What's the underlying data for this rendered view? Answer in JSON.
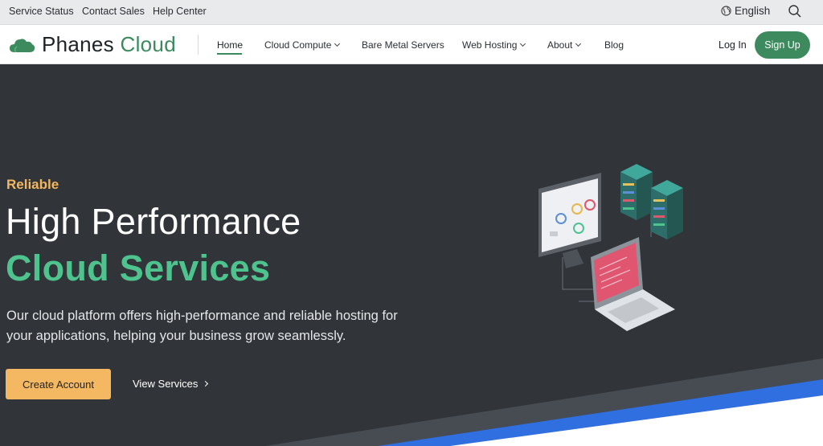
{
  "topbar": {
    "links": [
      "Service Status",
      "Contact Sales",
      "Help Center"
    ],
    "language": "English"
  },
  "nav": {
    "logo": {
      "part1": "Phanes",
      "part2": "Cloud"
    },
    "items": [
      {
        "label": "Home",
        "active": true
      },
      {
        "label": "Cloud Compute",
        "dropdown": true
      },
      {
        "label": "Bare Metal Servers"
      },
      {
        "label": "Web Hosting",
        "dropdown": true
      },
      {
        "label": "About",
        "dropdown": true
      },
      {
        "label": "Blog"
      }
    ],
    "login": "Log In",
    "signup": "Sign Up"
  },
  "hero": {
    "eyebrow": "Reliable",
    "title_line1": "High Performance",
    "title_line2": "Cloud Services",
    "description": "Our cloud platform offers high-performance and reliable hosting for your applications, helping your business grow seamlessly.",
    "primary_cta": "Create Account",
    "secondary_cta": "View Services"
  },
  "colors": {
    "brand_green": "#3d8a5e",
    "accent_orange": "#f5b862",
    "title_green": "#4ec38e",
    "hero_bg": "#313539",
    "stripe_blue": "#2f6fe0"
  }
}
